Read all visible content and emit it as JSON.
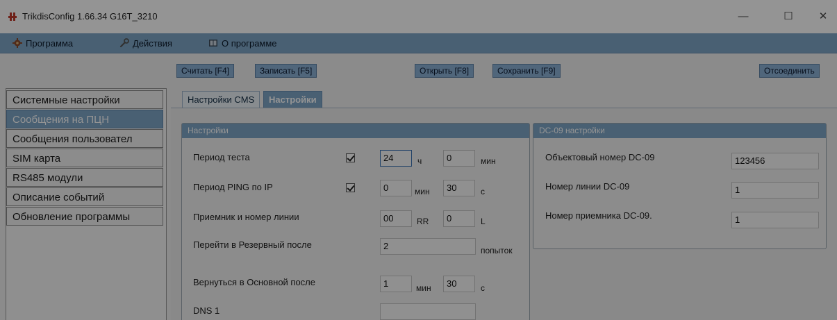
{
  "window": {
    "title": "TrikdisConfig 1.66.34   G16T_3210",
    "controls": {
      "minimize": "—",
      "maximize": "☐",
      "close": "✕"
    }
  },
  "menu": {
    "items": [
      {
        "label": "Программа",
        "icon": "gear-icon"
      },
      {
        "label": "Действия",
        "icon": "wrench-icon"
      },
      {
        "label": "О программе",
        "icon": "info-book-icon"
      }
    ]
  },
  "toolbar": {
    "read": "Считать [F4]",
    "write": "Записать [F5]",
    "open": "Открыть [F8]",
    "save": "Сохранить [F9]",
    "disconnect": "Отсоединить"
  },
  "sidebar": {
    "items": [
      {
        "label": "Системные настройки",
        "active": false
      },
      {
        "label": "Сообщения на ПЦН",
        "active": true
      },
      {
        "label": "Сообщения пользовател",
        "active": false
      },
      {
        "label": "SIM карта",
        "active": false
      },
      {
        "label": "RS485 модули",
        "active": false
      },
      {
        "label": "Описание событий",
        "active": false
      },
      {
        "label": "Обновление программы",
        "active": false
      }
    ]
  },
  "tabs": [
    {
      "label": "Настройки CMS",
      "active": false
    },
    {
      "label": "Настройки",
      "active": true
    }
  ],
  "settings": {
    "title": "Настройки",
    "test_period": {
      "label": "Период теста",
      "checked": true,
      "hours": "24",
      "hours_unit": "ч",
      "minutes": "0",
      "minutes_unit": "мин"
    },
    "ping_period": {
      "label": "Период PING по IP",
      "checked": true,
      "minutes": "0",
      "minutes_unit": "мин",
      "seconds": "30",
      "seconds_unit": "с"
    },
    "receiver_line": {
      "label": "Приемник и номер линии",
      "receiver": "00",
      "receiver_unit": "RR",
      "line": "0",
      "line_unit": "L"
    },
    "switch_backup": {
      "label": "Перейти в Резервный после",
      "value": "2",
      "unit": "попыток"
    },
    "return_main": {
      "label": "Вернуться в Основной после",
      "minutes": "1",
      "minutes_unit": "мин",
      "seconds": "30",
      "seconds_unit": "с"
    },
    "dns1": {
      "label": "DNS 1",
      "value": ""
    }
  },
  "dc09": {
    "title": "DC-09 настройки",
    "object_number": {
      "label": "Объектовый номер DC-09",
      "value": "123456"
    },
    "line_number": {
      "label": "Номер линии DC-09",
      "value": "1"
    },
    "receiver_number": {
      "label": "Номер приемника DC-09.",
      "value": "1"
    }
  },
  "colors": {
    "accent": "#7fa6c7",
    "button": "#8ab0d4",
    "active_item": "#7fa6c7"
  }
}
